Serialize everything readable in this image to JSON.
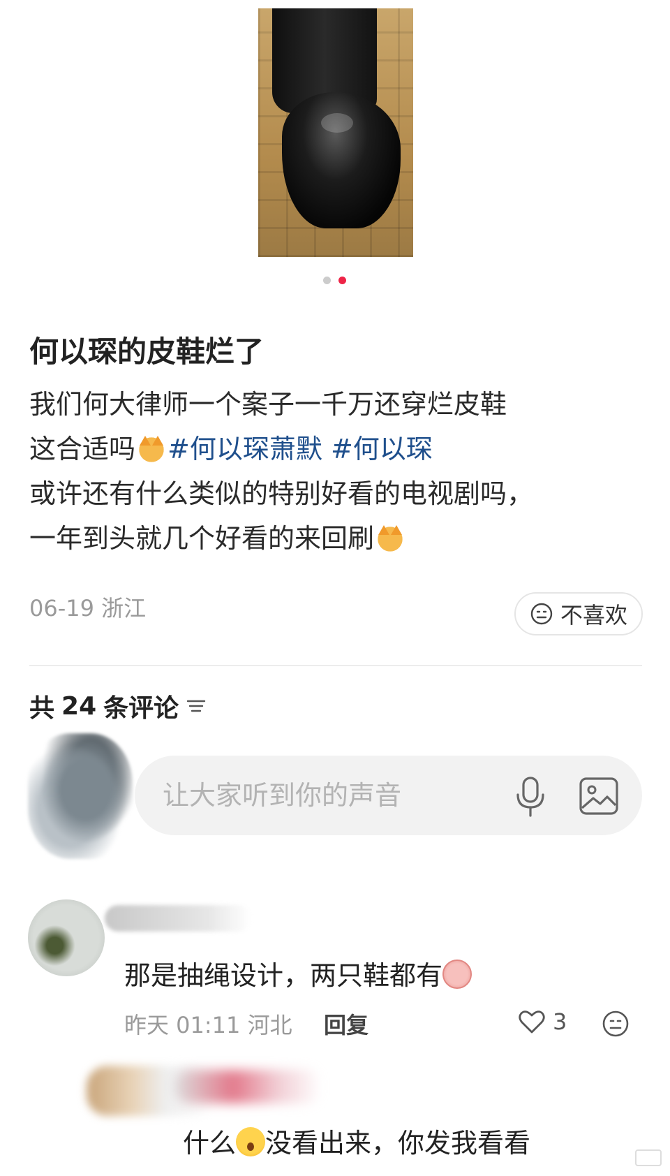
{
  "post": {
    "title": "何以琛的皮鞋烂了",
    "line1": "我们何大律师一个案子一千万还穿烂皮鞋",
    "line2_prefix": "这合适吗",
    "tag1": "#何以琛萧默",
    "tag2": "#何以琛",
    "line3": "或许还有什么类似的特别好看的电视剧吗，",
    "line4": "一年到头就几个好看的来回刷",
    "date": "06-19",
    "location": "浙江",
    "dislike_label": "不喜欢",
    "carousel": {
      "count": 2,
      "active": 2
    }
  },
  "comments_header": {
    "prefix": "共",
    "count": "24",
    "suffix": "条评论"
  },
  "input": {
    "placeholder": "让大家听到你的声音"
  },
  "comments": [
    {
      "text": "那是抽绳设计，两只鞋都有",
      "time": "昨天 01:11",
      "location": "河北",
      "reply_label": "回复",
      "likes": "3"
    },
    {
      "text_before": "什么",
      "text_after": "没看出来，你发我看看"
    }
  ],
  "icons": {
    "carousel_active_color": "#ee2447",
    "tag_color": "#1f4f8c"
  }
}
